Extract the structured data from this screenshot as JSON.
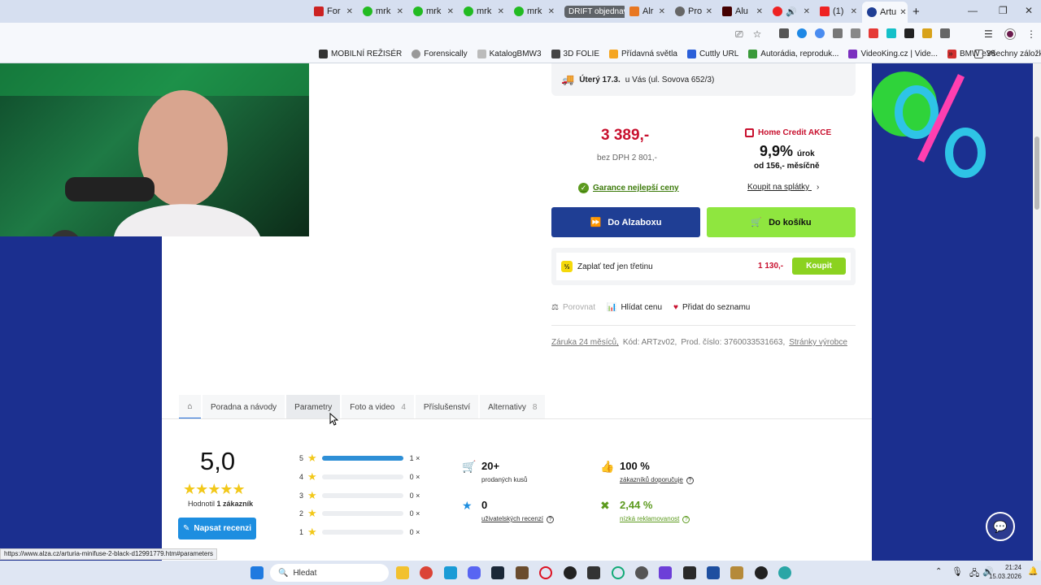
{
  "browser": {
    "tabs": [
      {
        "label": "For"
      },
      {
        "label": "mrk"
      },
      {
        "label": "mrk"
      },
      {
        "label": "mrk"
      },
      {
        "label": "mrk"
      },
      {
        "label": "DRIFT objednavky"
      },
      {
        "label": "Alr"
      },
      {
        "label": "Pro"
      },
      {
        "label": "Alu"
      },
      {
        "label": "(1)"
      },
      {
        "label": "Artu",
        "active": true
      }
    ],
    "bookmarks": [
      "MOBILNÍ REŽISÉR",
      "Forensically",
      "KatalogBMW3",
      "3D FOLIE",
      "Přídavná světla",
      "Cuttly URL",
      "Autorádia, reproduk...",
      "VideoKing.cz | Vide...",
      "BMW e36"
    ],
    "all_bookmarks": "Všechny záložky",
    "status_url": "https://www.alza.cz/arturia-minifuse-2-black-d12991779.htm#parameters"
  },
  "product": {
    "delivery_day": "Úterý 17.3.",
    "delivery_place": "u Vás (ul. Sovova 652/3)",
    "price": "3 389,-",
    "price_without_vat": "bez DPH 2 801,-",
    "home_credit_label": "Home Credit AKCE",
    "rate": "9,9%",
    "rate_suffix": "úrok",
    "monthly": "od 156,- měsíčně",
    "guarantee": "Garance nejlepší ceny",
    "installments_link": "Koupit na splátky",
    "btn_alzabox": "Do Alzaboxu",
    "btn_cart": "Do košíku",
    "third_label": "Zaplať teď jen třetinu",
    "third_price": "1 130,-",
    "third_btn": "Koupit",
    "third_icon": "⅓",
    "compare": "Porovnat",
    "watch_price": "Hlídat cenu",
    "add_to_list": "Přidat do seznamu",
    "warranty": "Záruka 24 měsíců,",
    "code": "Kód: ARTzv02,",
    "prod_no": "Prod. číslo: 3760033531663,",
    "maker_pages": "Stránky výrobce"
  },
  "product_tabs": [
    {
      "label": "Poradna a návody",
      "count": ""
    },
    {
      "label": "Parametry",
      "count": ""
    },
    {
      "label": "Foto a video",
      "count": "4"
    },
    {
      "label": "Příslušenství",
      "count": ""
    },
    {
      "label": "Alternativy",
      "count": "8"
    }
  ],
  "reviews": {
    "score": "5,0",
    "rated_by_prefix": "Hodnotil",
    "rated_by_value": "1 zákazník",
    "write_review": "Napsat recenzi",
    "distribution": [
      {
        "stars": "5",
        "count": "1 ×",
        "fraction": 1.0
      },
      {
        "stars": "4",
        "count": "0 ×",
        "fraction": 0
      },
      {
        "stars": "3",
        "count": "0 ×",
        "fraction": 0
      },
      {
        "stars": "2",
        "count": "0 ×",
        "fraction": 0
      },
      {
        "stars": "1",
        "count": "0 ×",
        "fraction": 0
      }
    ]
  },
  "stats": {
    "sold_value": "20+",
    "sold_label": "prodaných kusů",
    "recommend_value": "100 %",
    "recommend_label": "zákazníků doporučuje",
    "user_reviews_value": "0",
    "user_reviews_label": "uživatelských recenzí",
    "complaints_value": "2,44 %",
    "complaints_label": "nízká reklamovanost"
  },
  "taskbar": {
    "search_placeholder": "Hledat",
    "time": "21:24",
    "date": "15.03.2026"
  },
  "colors": {
    "accent_red": "#c8102e",
    "alza_blue": "#1f3e94",
    "cart_green": "#8fe63f",
    "star": "#f2c81a"
  }
}
